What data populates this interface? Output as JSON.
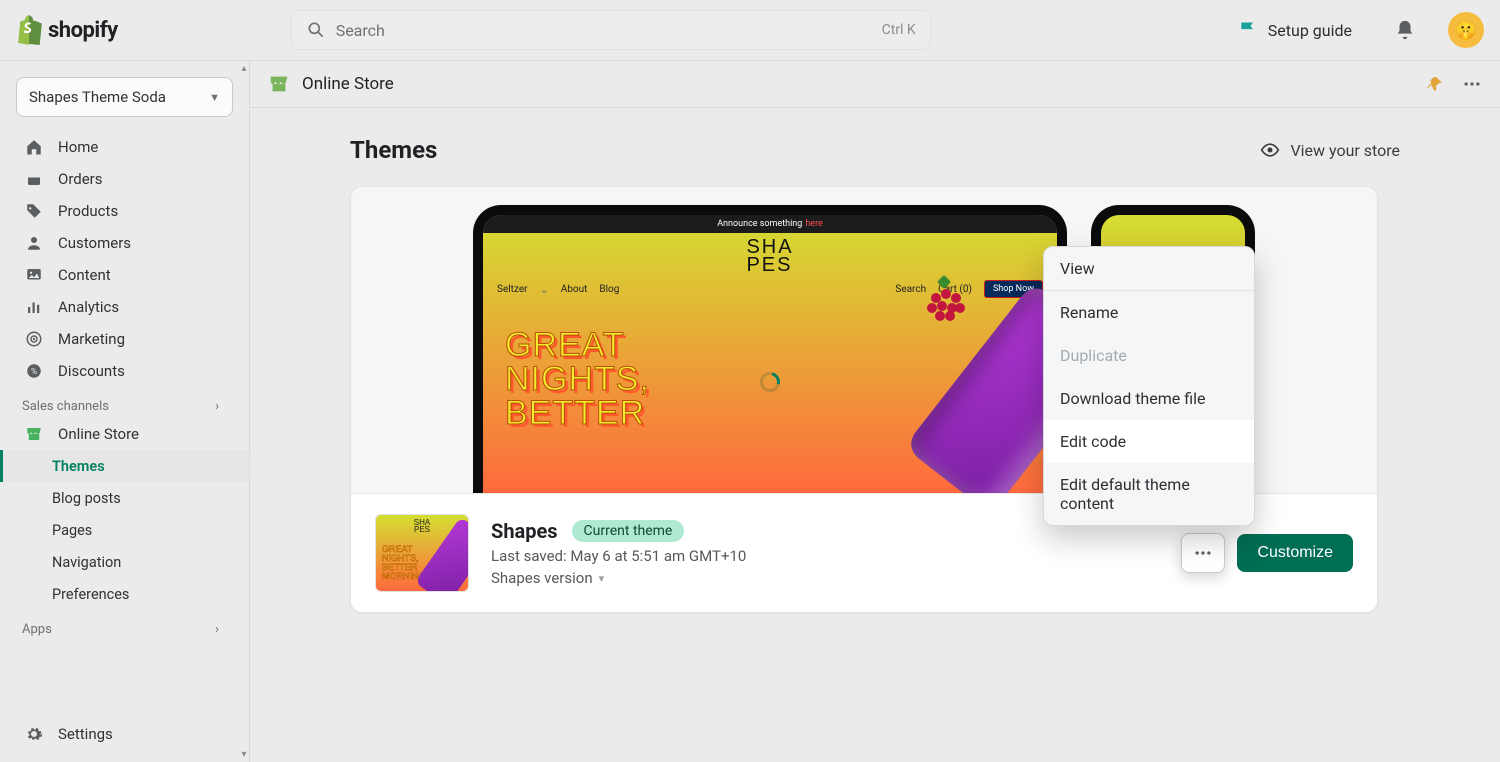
{
  "brand": "shopify",
  "search": {
    "placeholder": "Search",
    "shortcut": "Ctrl K"
  },
  "topbar": {
    "setup_guide": "Setup guide"
  },
  "store_selector": {
    "name": "Shapes Theme Soda"
  },
  "nav": {
    "home": "Home",
    "orders": "Orders",
    "products": "Products",
    "customers": "Customers",
    "content": "Content",
    "analytics": "Analytics",
    "marketing": "Marketing",
    "discounts": "Discounts",
    "sales_channels_label": "Sales channels",
    "online_store": "Online Store",
    "sub": {
      "themes": "Themes",
      "blog_posts": "Blog posts",
      "pages": "Pages",
      "navigation": "Navigation",
      "preferences": "Preferences"
    },
    "apps_label": "Apps",
    "settings": "Settings"
  },
  "breadcrumb": {
    "title": "Online Store"
  },
  "page": {
    "title": "Themes",
    "view_store": "View your store"
  },
  "preview": {
    "announce_a": "Announce something",
    "announce_b": "here",
    "brand_top": "SHA",
    "brand_bottom": "PES",
    "menu": {
      "seltzer": "Seltzer",
      "about": "About",
      "blog": "Blog",
      "search": "Search",
      "cart": "Cart (0)",
      "shop_now": "Shop Now"
    },
    "hero1": "GREAT",
    "hero2": "NIGHTS,",
    "hero3": "BETTER"
  },
  "theme": {
    "name": "Shapes",
    "badge": "Current theme",
    "last_saved": "Last saved: May 6 at 5:51 am GMT+10",
    "version_label": "Shapes version",
    "customize": "Customize"
  },
  "menu": {
    "view": "View",
    "rename": "Rename",
    "duplicate": "Duplicate",
    "download": "Download theme file",
    "edit_code": "Edit code",
    "edit_default": "Edit default theme content"
  }
}
